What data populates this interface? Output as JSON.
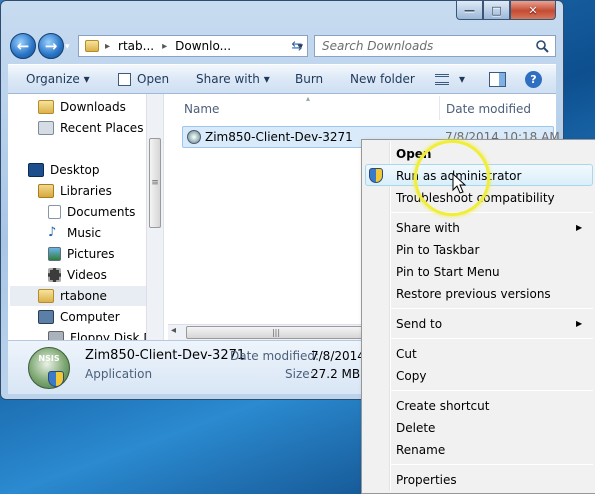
{
  "window": {
    "min": "—",
    "max": "□",
    "close": "✕"
  },
  "address": {
    "crumb1": "rtab...",
    "sep": "▸",
    "crumb2": "Downlo...",
    "dropdown": "▾",
    "refresh": "⇆"
  },
  "search": {
    "placeholder": "Search Downloads"
  },
  "toolbar": {
    "organize": "Organize ▾",
    "open": "Open",
    "share_with": "Share with ▾",
    "burn": "Burn",
    "new_folder": "New folder",
    "views": "▾",
    "help": "?"
  },
  "nav": {
    "items": [
      {
        "label": "Downloads"
      },
      {
        "label": "Recent Places"
      },
      {
        "label": "Desktop"
      },
      {
        "label": "Libraries"
      },
      {
        "label": "Documents"
      },
      {
        "label": "Music"
      },
      {
        "label": "Pictures"
      },
      {
        "label": "Videos"
      },
      {
        "label": "rtabone"
      },
      {
        "label": "Computer"
      },
      {
        "label": "Floppy Disk Dri..."
      }
    ]
  },
  "columns": {
    "name": "Name",
    "date_modified": "Date modified"
  },
  "files": [
    {
      "name": "Zim850-Client-Dev-3271",
      "date": "7/8/2014 10:18 AM"
    }
  ],
  "details": {
    "name": "Zim850-Client-Dev-3271",
    "type": "Application",
    "date_label": "Date modified:",
    "date_value": "7/8/2014",
    "size_label": "Size:",
    "size_value": "27.2 MB",
    "icon_text": "NSIS"
  },
  "context_menu": {
    "items": [
      {
        "label": "Open"
      },
      {
        "label": "Run as administrator"
      },
      {
        "label": "Troubleshoot compatibility"
      },
      {
        "label": "Share with"
      },
      {
        "label": "Pin to Taskbar"
      },
      {
        "label": "Pin to Start Menu"
      },
      {
        "label": "Restore previous versions"
      },
      {
        "label": "Send to"
      },
      {
        "label": "Cut"
      },
      {
        "label": "Copy"
      },
      {
        "label": "Create shortcut"
      },
      {
        "label": "Delete"
      },
      {
        "label": "Rename"
      },
      {
        "label": "Properties"
      }
    ],
    "submenu_arrow": "▶"
  },
  "hscroll": {
    "grip": "|||",
    "left": "◂",
    "right": "▸"
  },
  "vscroll": {
    "grip": "≡"
  },
  "colors": {
    "highlight": "#d9effa",
    "accent": "#2773c4",
    "cursor_ring": "#f0ee3a"
  }
}
